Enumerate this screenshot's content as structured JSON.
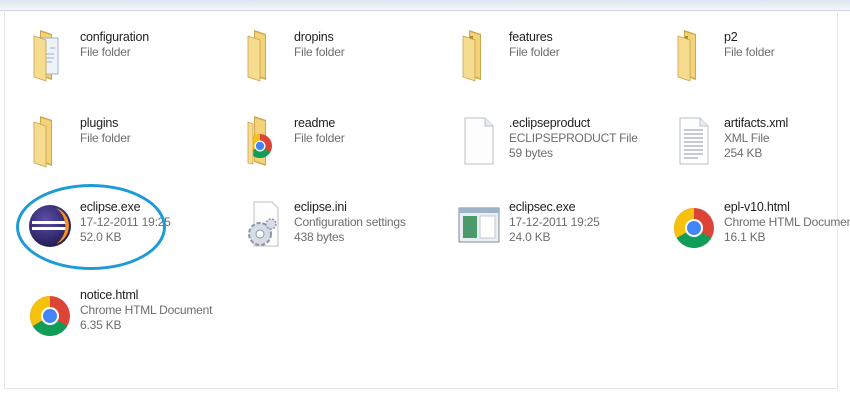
{
  "files": [
    {
      "name": "configuration",
      "line1": "File folder",
      "line2": "",
      "icon": "folder-document-icon"
    },
    {
      "name": "dropins",
      "line1": "File folder",
      "line2": "",
      "icon": "folder-icon"
    },
    {
      "name": "features",
      "line1": "File folder",
      "line2": "",
      "icon": "folder-icon"
    },
    {
      "name": "p2",
      "line1": "File folder",
      "line2": "",
      "icon": "folder-icon"
    },
    {
      "name": "plugins",
      "line1": "File folder",
      "line2": "",
      "icon": "folder-icon"
    },
    {
      "name": "readme",
      "line1": "File folder",
      "line2": "",
      "icon": "folder-chrome-icon"
    },
    {
      "name": ".eclipseproduct",
      "line1": "ECLIPSEPRODUCT File",
      "line2": "59 bytes",
      "icon": "blank-file-icon"
    },
    {
      "name": "artifacts.xml",
      "line1": "XML File",
      "line2": "254 KB",
      "icon": "text-file-icon"
    },
    {
      "name": "eclipse.exe",
      "line1": "17-12-2011 19:25",
      "line2": "52.0 KB",
      "icon": "eclipse-icon"
    },
    {
      "name": "eclipse.ini",
      "line1": "Configuration settings",
      "line2": "438 bytes",
      "icon": "settings-file-icon"
    },
    {
      "name": "eclipsec.exe",
      "line1": "17-12-2011 19:25",
      "line2": "24.0 KB",
      "icon": "application-window-icon"
    },
    {
      "name": "epl-v10.html",
      "line1": "Chrome HTML Document",
      "line2": "16.1 KB",
      "icon": "chrome-icon"
    },
    {
      "name": "notice.html",
      "line1": "Chrome HTML Document",
      "line2": "6.35 KB",
      "icon": "chrome-icon"
    }
  ],
  "highlight_color": "#1e9ad6"
}
